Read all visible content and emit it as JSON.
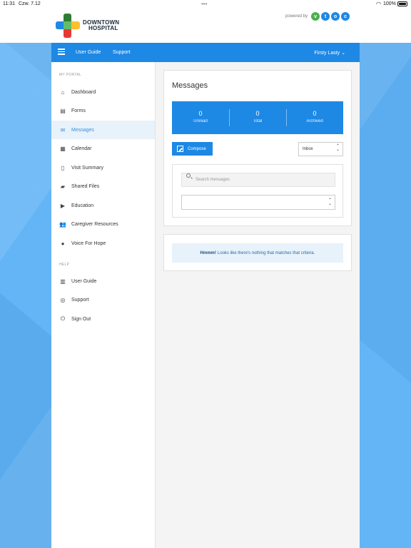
{
  "status_bar": {
    "time": "11:31",
    "date": "Czw. 7.12",
    "battery_pct": "100%",
    "battery_level": 1.0
  },
  "header": {
    "logo_line1": "DOWNTOWN",
    "logo_line2": "HOSPITAL",
    "powered_by": "powered by",
    "vtoc_letters": [
      "v",
      "t",
      "o",
      "c"
    ],
    "vtoc_colors": [
      "#4caf50",
      "#1e88e5",
      "#1e88e5",
      "#1e88e5"
    ]
  },
  "topnav": {
    "user_guide": "User Guide",
    "support": "Support",
    "user_name": "Firsty Lasty"
  },
  "sidebar": {
    "portal_heading": "MY PORTAL",
    "help_heading": "HELP",
    "portal_items": [
      {
        "label": "Dashboard",
        "icon": "home-icon"
      },
      {
        "label": "Forms",
        "icon": "forms-icon"
      },
      {
        "label": "Messages",
        "icon": "messages-icon",
        "active": true
      },
      {
        "label": "Calendar",
        "icon": "calendar-icon"
      },
      {
        "label": "Visit Summary",
        "icon": "document-icon"
      },
      {
        "label": "Shared Files",
        "icon": "folder-icon"
      },
      {
        "label": "Education",
        "icon": "video-icon"
      },
      {
        "label": "Caregiver Resources",
        "icon": "group-icon"
      },
      {
        "label": "Voice For Hope",
        "icon": "chat-icon"
      }
    ],
    "help_items": [
      {
        "label": "User Guide",
        "icon": "book-icon"
      },
      {
        "label": "Support",
        "icon": "lifebuoy-icon"
      },
      {
        "label": "Sign Out",
        "icon": "power-icon"
      }
    ]
  },
  "messages": {
    "title": "Messages",
    "stats": [
      {
        "value": "0",
        "label": "Unread"
      },
      {
        "value": "0",
        "label": "Total"
      },
      {
        "value": "0",
        "label": "Archived"
      }
    ],
    "compose_label": "Compose",
    "folder_selected": "Inbox",
    "search_placeholder": "Search messages",
    "filter_selected": ""
  },
  "notice": {
    "bold": "Hmmm!",
    "text": "Looks like there's nothing that matches that criteria."
  },
  "colors": {
    "brand_blue": "#1e88e5",
    "background_blue": "#64b5f6",
    "active_highlight": "#e8f2fb"
  }
}
